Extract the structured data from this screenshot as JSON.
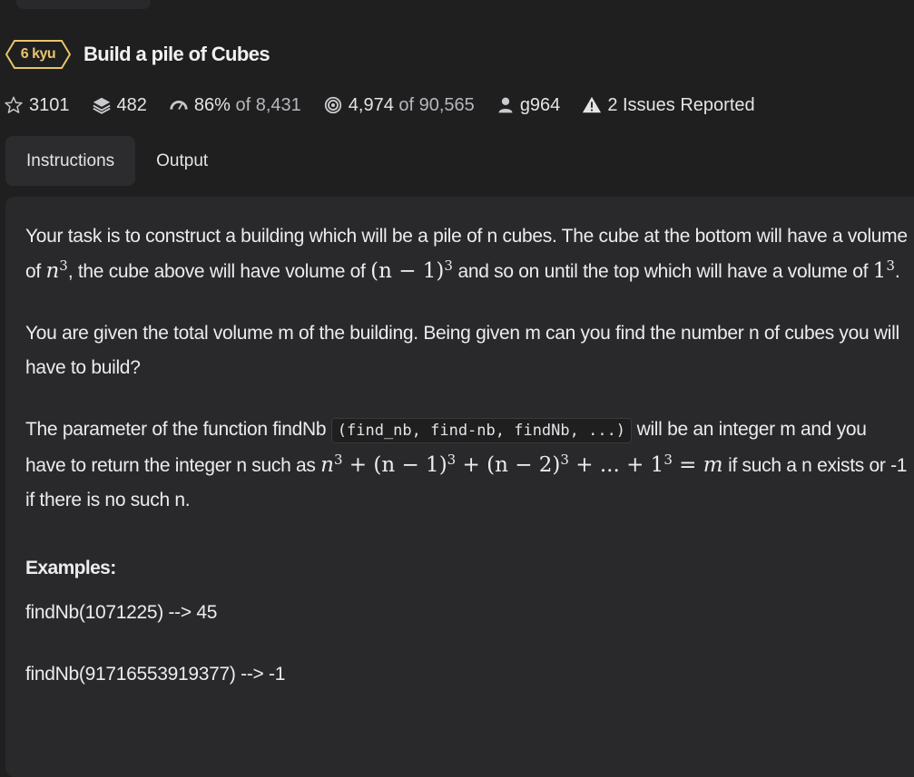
{
  "kata": {
    "rank": "6 kyu",
    "title": "Build a pile of Cubes",
    "colors": {
      "rank": "#e9c46a",
      "background": "#1f1f20",
      "panel": "#29292b"
    }
  },
  "stats": {
    "stars": "3101",
    "collections": "482",
    "satisfaction_pct": "86%",
    "satisfaction_of": "of 8,431",
    "completed": "4,974",
    "completed_of": "of 90,565",
    "author": "g964",
    "issues": "2 Issues Reported"
  },
  "tabs": [
    {
      "label": "Instructions",
      "active": true
    },
    {
      "label": "Output",
      "active": false
    }
  ],
  "description": {
    "p1_part1": "Your task is to construct a building which will be a pile of n cubes. The cube at the bottom will have a volume of ",
    "p1_math1": "n",
    "p1_part2": ", the cube above will have volume of ",
    "p1_math2": "(n − 1)",
    "p1_part3": " and so on until the top which will have a volume of ",
    "p1_math3": "1",
    "p1_part4": ".",
    "exp": "3",
    "p2": "You are given the total volume m of the building. Being given m can you find the number n of cubes you will have to build?",
    "p3_part1": "The parameter of the function findNb ",
    "p3_code": "(find_nb, find-nb, findNb, ...)",
    "p3_part2": " will be an integer m and you have to return the integer n such as ",
    "p3_m1": "n",
    "p3_m2": " + (n − 1)",
    "p3_m3": " + (n − 2)",
    "p3_m4": " + ... + 1",
    "p3_m5": " = ",
    "p3_m6": "m",
    "p3_part3": " if such a n exists or -1 if there is no such n."
  },
  "examples": {
    "heading": "Examples:",
    "items": [
      "findNb(1071225) --> 45",
      "findNb(91716553919377) --> -1"
    ]
  }
}
